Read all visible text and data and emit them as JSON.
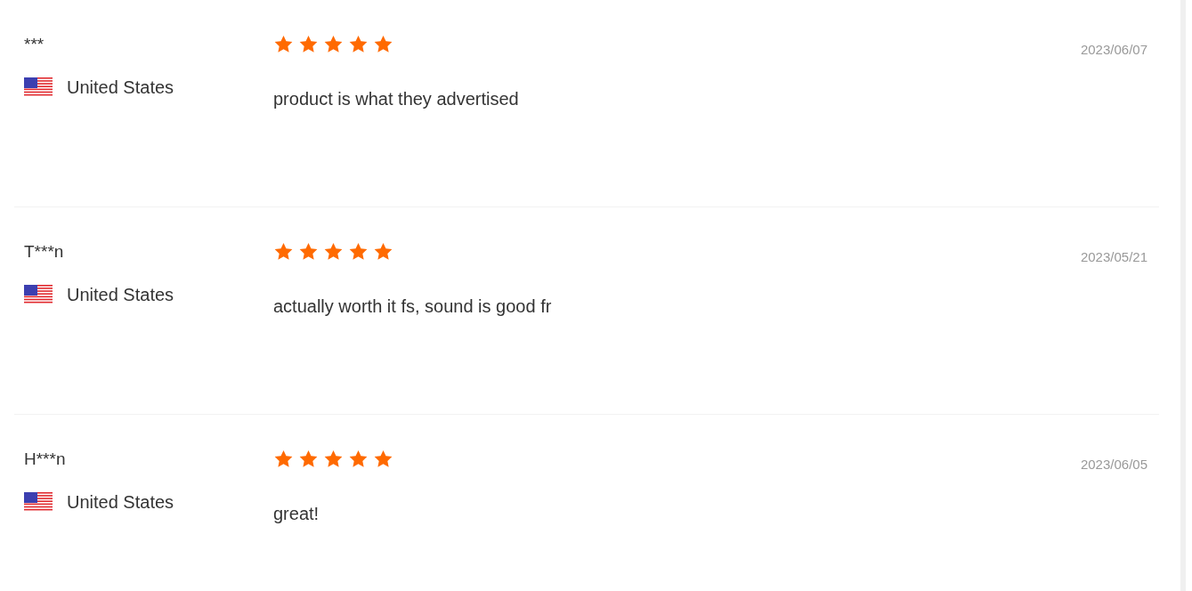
{
  "reviews": [
    {
      "name": "***",
      "country": "United States",
      "stars": 5,
      "date": "2023/06/07",
      "text": "product is what they advertised"
    },
    {
      "name": "T***n",
      "country": "United States",
      "stars": 5,
      "date": "2023/05/21",
      "text": "actually worth it fs, sound is good fr"
    },
    {
      "name": "H***n",
      "country": "United States",
      "stars": 5,
      "date": "2023/06/05",
      "text": "great!"
    }
  ]
}
